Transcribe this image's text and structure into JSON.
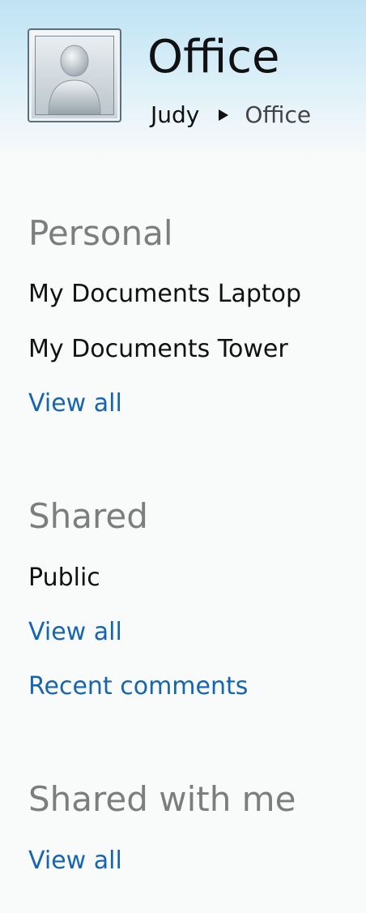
{
  "header": {
    "title": "Office",
    "breadcrumb": {
      "parent": "Judy",
      "current": "Office"
    },
    "avatar_icon": "user-silhouette-icon"
  },
  "sections": {
    "personal": {
      "heading": "Personal",
      "items": [
        "My Documents Laptop",
        "My Documents Tower"
      ],
      "view_all": "View all"
    },
    "shared": {
      "heading": "Shared",
      "items": [
        "Public"
      ],
      "view_all": "View all",
      "recent_comments": "Recent comments"
    },
    "shared_with_me": {
      "heading": "Shared with me",
      "view_all": "View all"
    }
  },
  "colors": {
    "link": "#1565b3",
    "heading": "#7d7d7d",
    "header_gradient_top": "#bfe3f4"
  }
}
